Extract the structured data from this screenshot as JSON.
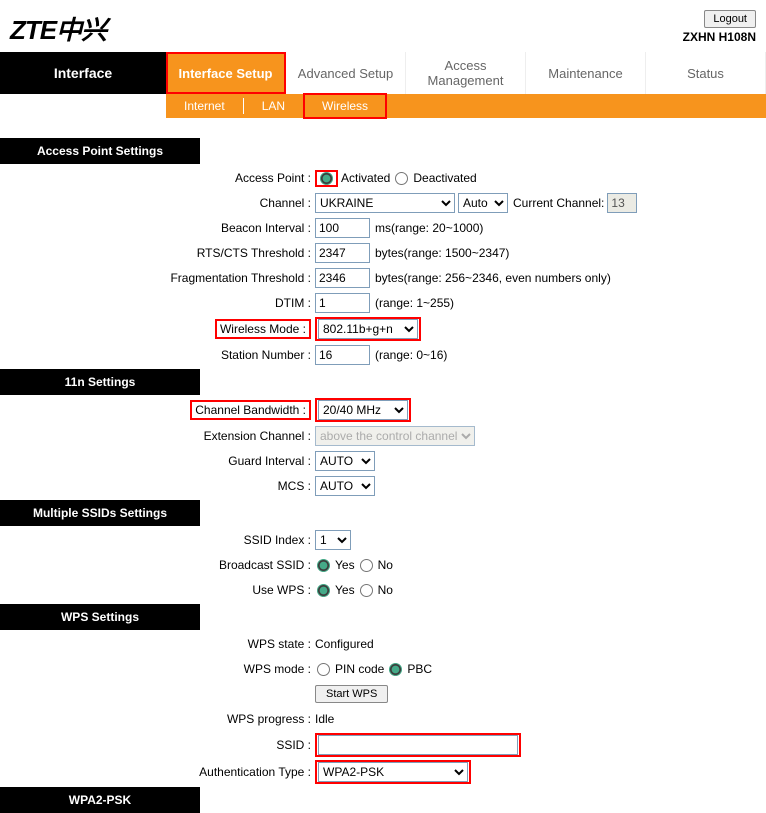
{
  "header": {
    "logo": "ZTE中兴",
    "logout": "Logout",
    "model": "ZXHN H108N"
  },
  "nav": {
    "left": "Interface",
    "items": [
      "Interface Setup",
      "Advanced Setup",
      "Access Management",
      "Maintenance",
      "Status"
    ]
  },
  "subnav": {
    "items": [
      "Internet",
      "LAN",
      "Wireless"
    ]
  },
  "sections": {
    "ap": "Access Point Settings",
    "n11": "11n Settings",
    "mssid": "Multiple SSIDs Settings",
    "wps": "WPS Settings",
    "wpa2": "WPA2-PSK"
  },
  "labels": {
    "access_point": "Access Point :",
    "activated": "Activated",
    "deactivated": "Deactivated",
    "channel": "Channel :",
    "current_channel": "Current Channel:",
    "beacon": "Beacon Interval :",
    "beacon_hint": "ms(range: 20~1000)",
    "rts": "RTS/CTS Threshold :",
    "rts_hint": "bytes(range: 1500~2347)",
    "frag": "Fragmentation Threshold :",
    "frag_hint": "bytes(range: 256~2346, even numbers only)",
    "dtim": "DTIM :",
    "dtim_hint": "(range: 1~255)",
    "wmode": "Wireless Mode :",
    "station": "Station Number :",
    "station_hint": "(range: 0~16)",
    "cbw": "Channel Bandwidth :",
    "ext": "Extension Channel :",
    "guard": "Guard Interval :",
    "mcs": "MCS :",
    "ssid_index": "SSID Index :",
    "bcast": "Broadcast SSID :",
    "use_wps": "Use WPS :",
    "yes": "Yes",
    "no": "No",
    "wps_state": "WPS state :",
    "wps_mode": "WPS mode :",
    "pin": "PIN code",
    "pbc": "PBC",
    "start_wps": "Start WPS",
    "wps_prog": "WPS progress :",
    "ssid": "SSID :",
    "auth": "Authentication Type :"
  },
  "values": {
    "channel_country": "UKRAINE",
    "channel_auto": "Auto",
    "current_channel": "13",
    "beacon": "100",
    "rts": "2347",
    "frag": "2346",
    "dtim": "1",
    "wmode": "802.11b+g+n",
    "station": "16",
    "cbw": "20/40 MHz",
    "ext": "above the control channel",
    "guard": "AUTO",
    "mcs": "AUTO",
    "ssid_index": "1",
    "wps_state": "Configured",
    "wps_prog": "Idle",
    "ssid": "",
    "auth": "WPA2-PSK"
  }
}
